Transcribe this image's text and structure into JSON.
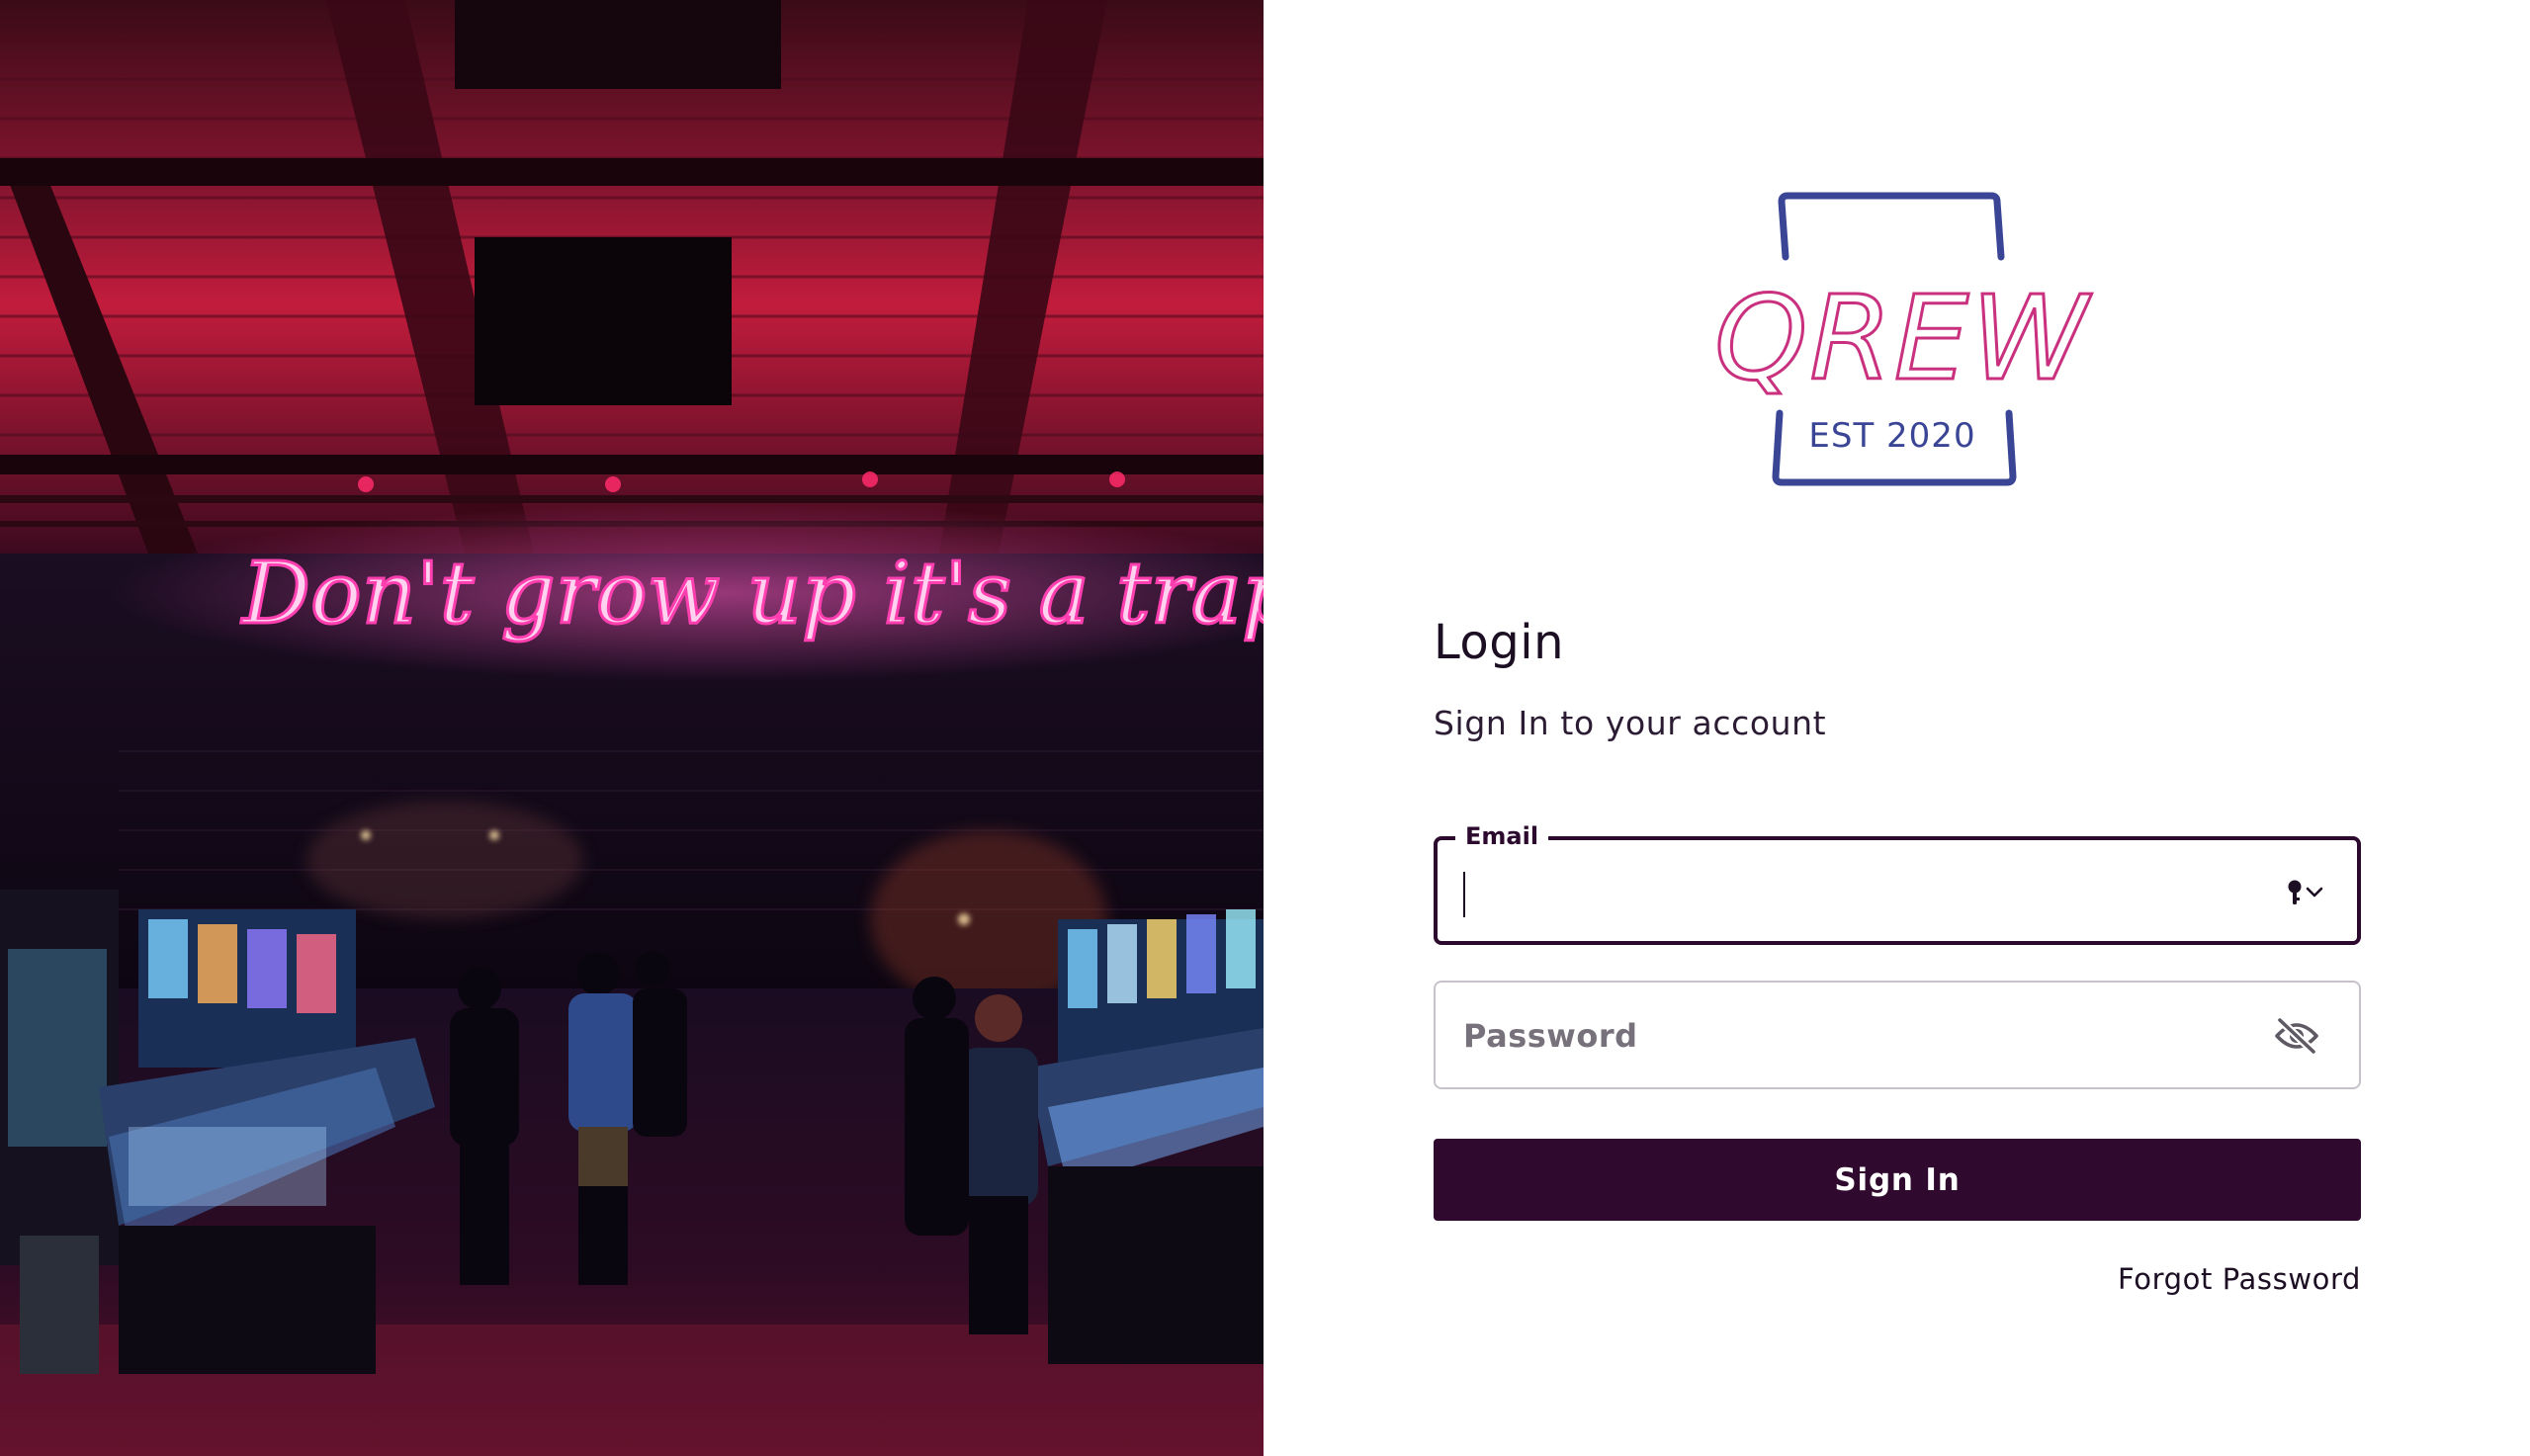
{
  "hero": {
    "neon_sign_text": "Don't grow up it's a trap"
  },
  "logo": {
    "wordmark": "QREW",
    "tagline": "EST 2020"
  },
  "login": {
    "title": "Login",
    "subtitle": "Sign In to your account"
  },
  "email": {
    "label": "Email",
    "value": "",
    "state": "focused"
  },
  "password": {
    "placeholder": "Password",
    "value": "",
    "visibility": "hidden"
  },
  "actions": {
    "signin_label": "Sign In",
    "forgot_label": "Forgot Password"
  },
  "colors": {
    "primary": "#300a2e",
    "text": "#1c0e23",
    "logo_blue": "#3a4596",
    "logo_pink": "#c9317f",
    "neon_pink": "#ff4fb8"
  },
  "icons": {
    "email_field_icon": "key-icon",
    "password_toggle_icon": "eye-off-icon"
  }
}
